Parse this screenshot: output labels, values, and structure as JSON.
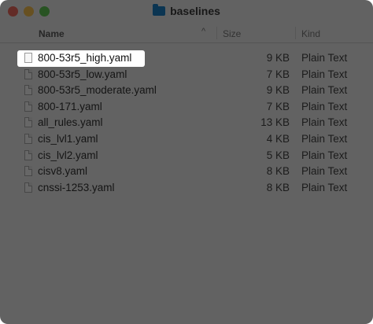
{
  "window": {
    "title": "baselines",
    "icon": "folder-icon"
  },
  "columns": {
    "name": "Name",
    "size": "Size",
    "kind": "Kind"
  },
  "files": [
    {
      "name": "800-53r5_high.yaml",
      "size": "9 KB",
      "kind": "Plain Text",
      "selected": true
    },
    {
      "name": "800-53r5_low.yaml",
      "size": "7 KB",
      "kind": "Plain Text"
    },
    {
      "name": "800-53r5_moderate.yaml",
      "size": "9 KB",
      "kind": "Plain Text"
    },
    {
      "name": "800-171.yaml",
      "size": "7 KB",
      "kind": "Plain Text"
    },
    {
      "name": "all_rules.yaml",
      "size": "13 KB",
      "kind": "Plain Text"
    },
    {
      "name": "cis_lvl1.yaml",
      "size": "4 KB",
      "kind": "Plain Text"
    },
    {
      "name": "cis_lvl2.yaml",
      "size": "5 KB",
      "kind": "Plain Text"
    },
    {
      "name": "cisv8.yaml",
      "size": "8 KB",
      "kind": "Plain Text"
    },
    {
      "name": "cnssi-1253.yaml",
      "size": "8 KB",
      "kind": "Plain Text"
    }
  ],
  "colors": {
    "close": "#ed6a5e",
    "minimize": "#f5bf4f",
    "maximize": "#61c554",
    "folder": "#1b7fc4"
  }
}
